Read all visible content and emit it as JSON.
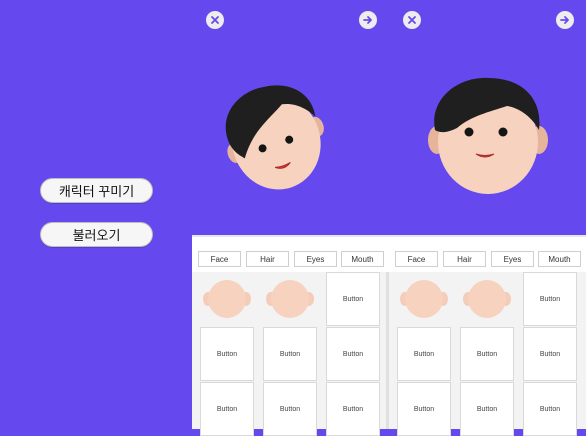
{
  "menu": {
    "customize_label": "캐릭터 꾸미기",
    "load_label": "불러오기"
  },
  "icons": {
    "close": "close-icon",
    "next": "arrow-right-icon"
  },
  "tabs": [
    "Face",
    "Hair",
    "Eyes",
    "Mouth"
  ],
  "grid": {
    "button_label": "Button",
    "face_option": "face-color-swatch"
  },
  "colors": {
    "background": "#6649ee",
    "skin": "#f6d2bf",
    "hair": "#1f1f1f",
    "lips": "#d23a3a"
  }
}
